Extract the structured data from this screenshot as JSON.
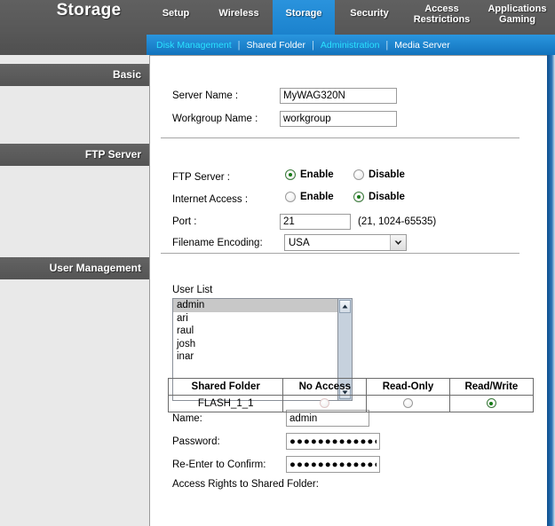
{
  "header": {
    "brand_title": "Storage",
    "main_tabs": [
      {
        "label": "Setup",
        "active": false
      },
      {
        "label": "Wireless",
        "active": false
      },
      {
        "label": "Storage",
        "active": true
      },
      {
        "label": "Security",
        "active": false
      },
      {
        "label": "Access Restrictions",
        "active": false
      },
      {
        "label": "Applications Gaming",
        "active": false
      }
    ],
    "sub_tabs": [
      {
        "label": "Disk Management",
        "style": "link"
      },
      {
        "label": "Shared Folder",
        "style": "plain"
      },
      {
        "label": "Administration",
        "style": "link"
      },
      {
        "label": "Media Server",
        "style": "plain"
      }
    ],
    "divider": "|"
  },
  "sidebar": {
    "sections": [
      {
        "label": "Basic"
      },
      {
        "label": "FTP Server"
      },
      {
        "label": "User Management"
      }
    ]
  },
  "basic": {
    "server_name_label": "Server Name :",
    "server_name_value": "MyWAG320N",
    "workgroup_name_label": "Workgroup Name :",
    "workgroup_name_value": "workgroup"
  },
  "ftp": {
    "ftp_server_label": "FTP Server :",
    "ftp_enable_label": "Enable",
    "ftp_disable_label": "Disable",
    "ftp_selected": "Enable",
    "internet_access_label": "Internet Access :",
    "internet_enable_label": "Enable",
    "internet_disable_label": "Disable",
    "internet_selected": "Disable",
    "port_label": "Port :",
    "port_value": "21",
    "port_hint": "(21, 1024-65535)",
    "encoding_label": "Filename Encoding:",
    "encoding_value": "USA"
  },
  "user_management": {
    "user_list_label": "User List",
    "users": [
      "admin",
      "ari",
      "raul",
      "josh",
      "inar"
    ],
    "selected_user": "admin",
    "name_label": "Name:",
    "name_value": "admin",
    "password_label": "Password:",
    "password_value": "●●●●●●●●●●●●●●",
    "confirm_label": "Re-Enter to Confirm:",
    "confirm_value": "●●●●●●●●●●●●●●",
    "access_rights_label": "Access Rights to Shared Folder:",
    "table": {
      "columns": [
        "Shared Folder",
        "No Access",
        "Read-Only",
        "Read/Write"
      ],
      "rows": [
        {
          "folder": "FLASH_1_1",
          "no_access": false,
          "read_only": false,
          "read_write": true
        }
      ]
    }
  },
  "colors": {
    "header_gray": "#595959",
    "tab_blue": "#1b84cf",
    "sub_link_cyan": "#2ae2ff",
    "radio_green": "#167a16",
    "right_border_blue": "#1c5f9e"
  },
  "icons": {
    "chevron_down": "chevron-down-icon",
    "scroll_up": "scroll-up-arrow-icon",
    "scroll_down": "scroll-down-arrow-icon"
  }
}
